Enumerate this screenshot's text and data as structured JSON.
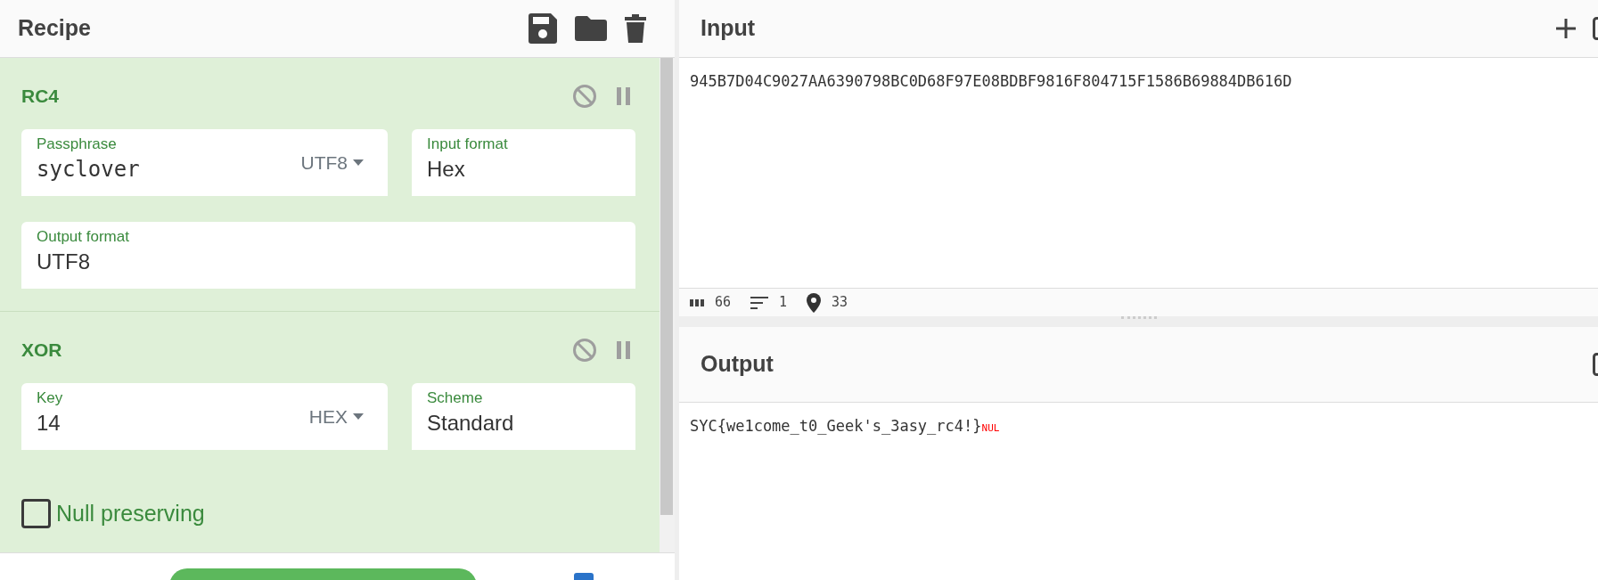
{
  "recipe": {
    "title": "Recipe",
    "operations": [
      {
        "name": "RC4",
        "disabled": false,
        "paused": false,
        "fields": [
          {
            "kind": "option_text",
            "label": "Passphrase",
            "value": "syclover",
            "option": "UTF8",
            "mono": true
          },
          {
            "kind": "select",
            "label": "Input format",
            "value": "Hex"
          },
          {
            "kind": "select_wide",
            "label": "Output format",
            "value": "UTF8"
          }
        ]
      },
      {
        "name": "XOR",
        "disabled": false,
        "paused": false,
        "fields": [
          {
            "kind": "option_text",
            "label": "Key",
            "value": "14",
            "option": "HEX",
            "mono": false
          },
          {
            "kind": "select",
            "label": "Scheme",
            "value": "Standard"
          },
          {
            "kind": "checkbox",
            "label": "Null preserving",
            "checked": false
          }
        ]
      }
    ]
  },
  "input": {
    "title": "Input",
    "text": "945B7D04C9027AA6390798BC0D68F97E08BDBF9816F804715F1586B69884DB616D",
    "stats": [
      {
        "kind": "length",
        "value": "66"
      },
      {
        "kind": "lines",
        "value": "1"
      },
      {
        "kind": "position",
        "value": "33"
      }
    ]
  },
  "output": {
    "title": "Output",
    "text": "SYC{we1come_t0_Geek's_3asy_rc4!}",
    "control_char": "NUL"
  },
  "footer": {
    "checkbox": {
      "checked": true
    }
  }
}
